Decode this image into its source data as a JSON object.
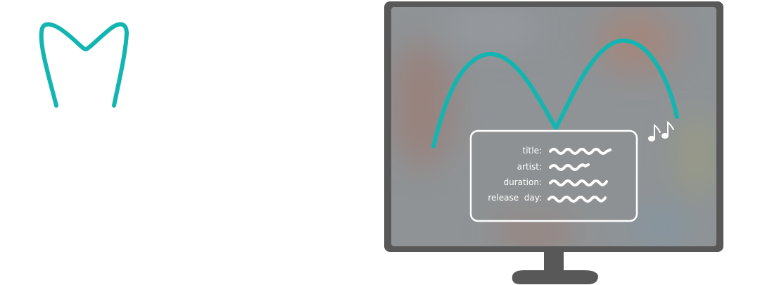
{
  "colors": {
    "accent": "#13b5b1",
    "bezel": "#585858",
    "screen": "#8f9396",
    "text": "#ffffff",
    "background": "#ffffff"
  },
  "icons": {
    "logo": "m-curve-logo",
    "notes": "music-notes-icon"
  },
  "info_panel": {
    "fields": [
      {
        "label": "title:"
      },
      {
        "label": "artist:"
      },
      {
        "label": "duration:"
      },
      {
        "label": "release  day:"
      }
    ]
  }
}
